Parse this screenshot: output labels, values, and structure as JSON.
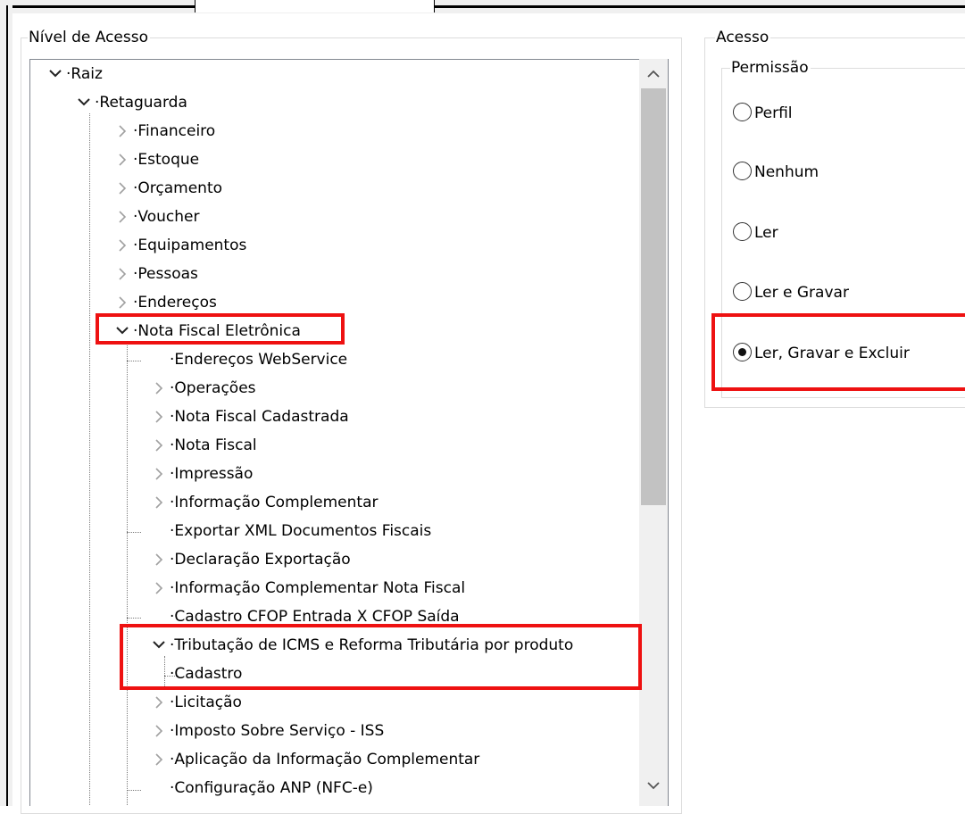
{
  "access_level": {
    "title": "Nível de Acesso",
    "tree": [
      {
        "label": "Raiz",
        "expander": "chevron-down"
      },
      {
        "label": "Retaguarda",
        "expander": "chevron-down"
      },
      {
        "label": "Financeiro",
        "expander": "chevron-right"
      },
      {
        "label": "Estoque",
        "expander": "chevron-right"
      },
      {
        "label": "Orçamento",
        "expander": "chevron-right"
      },
      {
        "label": "Voucher",
        "expander": "chevron-right"
      },
      {
        "label": "Equipamentos",
        "expander": "chevron-right"
      },
      {
        "label": "Pessoas",
        "expander": "chevron-right"
      },
      {
        "label": "Endereços",
        "expander": "chevron-right"
      },
      {
        "label": "Nota Fiscal Eletrônica",
        "expander": "chevron-down"
      },
      {
        "label": "Endereços WebService",
        "expander": "none"
      },
      {
        "label": "Operações",
        "expander": "chevron-right"
      },
      {
        "label": "Nota Fiscal Cadastrada",
        "expander": "chevron-right"
      },
      {
        "label": "Nota Fiscal",
        "expander": "chevron-right"
      },
      {
        "label": "Impressão",
        "expander": "chevron-right"
      },
      {
        "label": "Informação Complementar",
        "expander": "chevron-right"
      },
      {
        "label": "Exportar XML Documentos Fiscais",
        "expander": "none"
      },
      {
        "label": "Declaração Exportação",
        "expander": "chevron-right"
      },
      {
        "label": "Informação Complementar Nota Fiscal",
        "expander": "chevron-right"
      },
      {
        "label": "Cadastro CFOP Entrada X CFOP Saída",
        "expander": "none"
      },
      {
        "label": "Tributação de ICMS e Reforma Tributária por produto",
        "expander": "chevron-down"
      },
      {
        "label": "Cadastro",
        "expander": "none"
      },
      {
        "label": "Licitação",
        "expander": "chevron-right"
      },
      {
        "label": "Imposto Sobre Serviço - ISS",
        "expander": "chevron-right"
      },
      {
        "label": "Aplicação da Informação Complementar",
        "expander": "chevron-right"
      },
      {
        "label": "Configuração ANP (NFC-e)",
        "expander": "none"
      }
    ],
    "scroll_up_icon": "chevron-up-icon",
    "scroll_down_icon": "chevron-down-icon"
  },
  "access": {
    "title": "Acesso",
    "permission": {
      "title": "Permissão",
      "options": [
        {
          "label": "Perfil",
          "checked": false
        },
        {
          "label": "Nenhum",
          "checked": false
        },
        {
          "label": "Ler",
          "checked": false
        },
        {
          "label": "Ler e Gravar",
          "checked": false
        },
        {
          "label": "Ler, Gravar e Excluir",
          "checked": true
        }
      ]
    }
  },
  "colors": {
    "highlight": "#ee1111",
    "scroll_thumb": "#c2c2c2",
    "tree_border": "#828790"
  }
}
